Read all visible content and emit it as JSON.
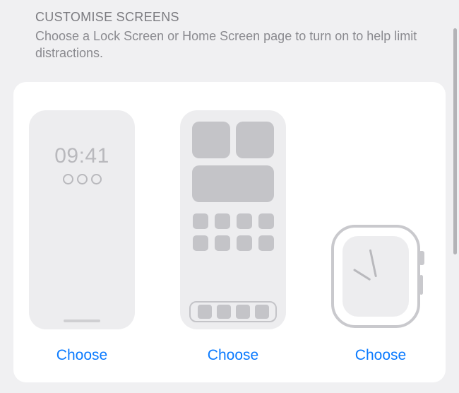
{
  "section": {
    "title": "CUSTOMISE SCREENS",
    "description": "Choose a Lock Screen or Home Screen page to turn on to help limit distractions."
  },
  "options": {
    "lock_screen": {
      "time": "09:41",
      "choose_label": "Choose"
    },
    "home_screen": {
      "choose_label": "Choose"
    },
    "watch": {
      "choose_label": "Choose"
    }
  }
}
